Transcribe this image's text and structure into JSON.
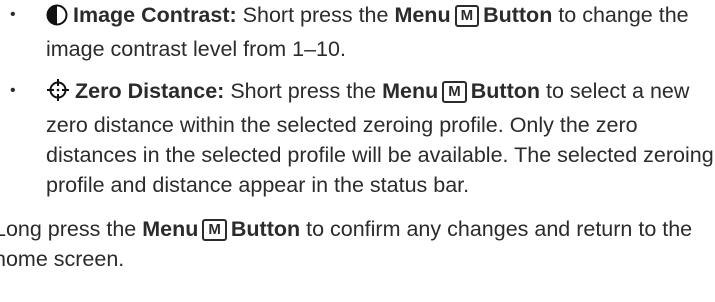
{
  "bullets": [
    {
      "icon": "contrast-icon",
      "title": "Image Contrast:",
      "text_1": "Short press the",
      "button_name": "Menu",
      "key_label": "M",
      "button_word": "Button",
      "text_2": "to change the image contrast level from 1–10."
    },
    {
      "icon": "crosshair-icon",
      "title": "Zero Distance:",
      "text_1": "Short press the",
      "button_name": "Menu",
      "key_label": "M",
      "button_word": "Button",
      "text_2": "to select a new zero distance within the selected zeroing profile. Only the zero distances in the selected profile will be available. The selected zeroing profile and distance appear in the status bar."
    }
  ],
  "closing": {
    "text_1": "Long press the",
    "button_name": "Menu",
    "key_label": "M",
    "button_word": "Button",
    "text_2": "to confirm any changes and return to the home screen."
  }
}
